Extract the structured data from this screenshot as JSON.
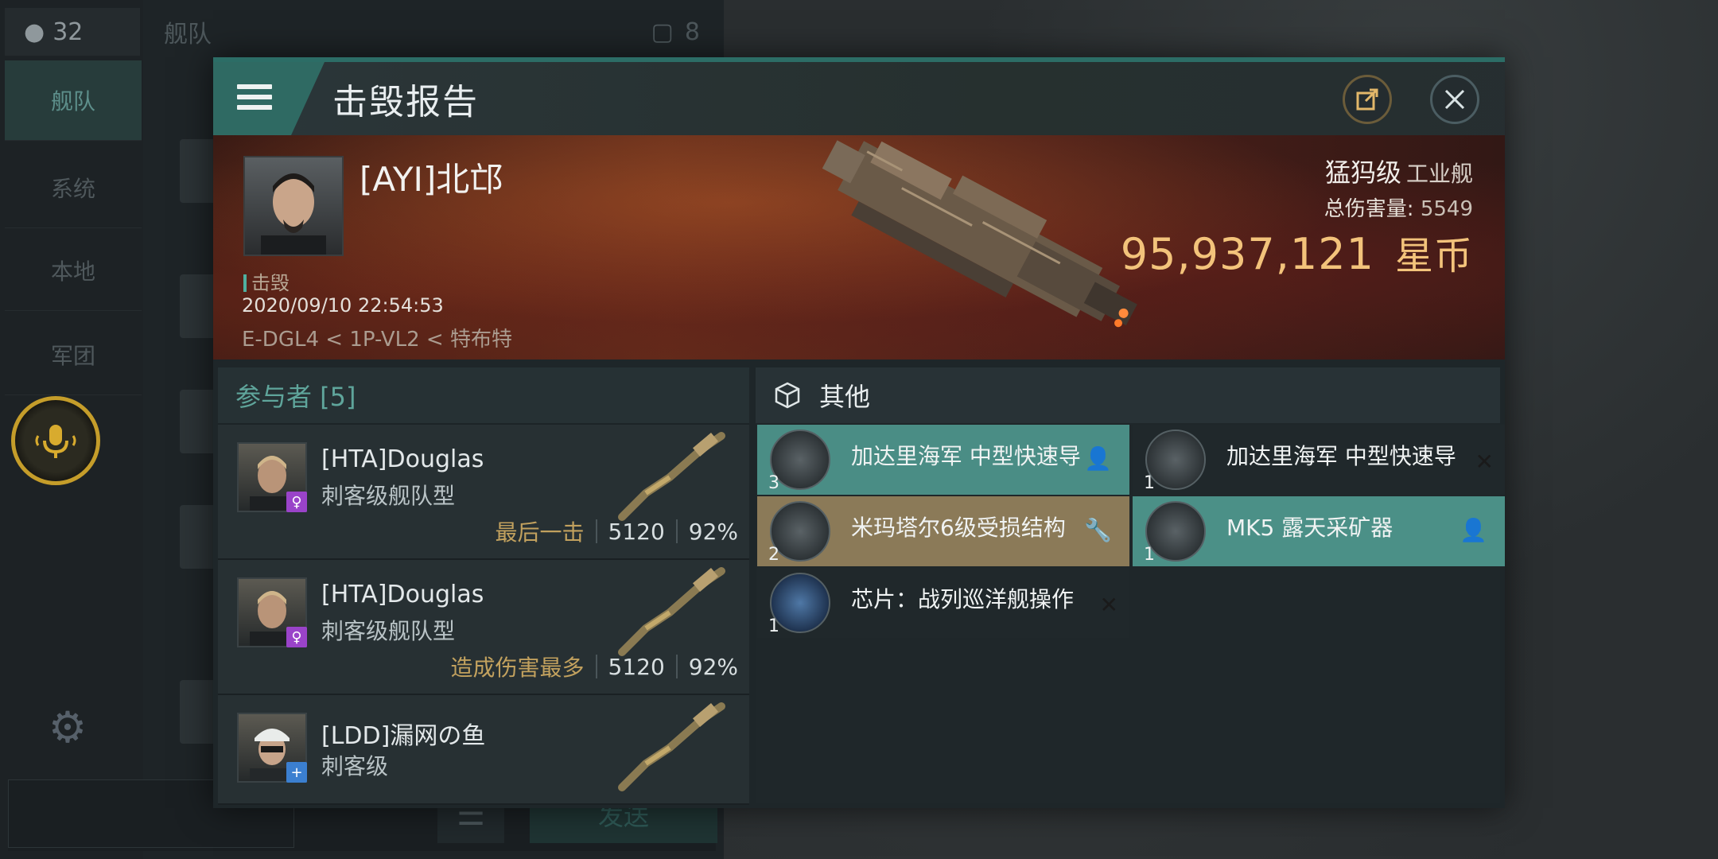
{
  "background": {
    "player_count": "32",
    "tabs": [
      "舰队",
      "系统",
      "本地",
      "军团"
    ],
    "chat_title": "舰队",
    "chat_member_count": "8",
    "input_placeholder": "",
    "send_label": "发送"
  },
  "modal": {
    "title": "击毁报告",
    "victim": {
      "name": "[AYI]北邙",
      "status": "击毁",
      "time": "2020/09/10 22:54:53",
      "location": "E-DGL4 < 1P-VL2 < 特布特"
    },
    "ship": {
      "class_name": "猛犸级",
      "class_type": "工业舰",
      "total_damage_label": "总伤害量:",
      "total_damage_value": "5549",
      "isk_value": "95,937,121",
      "currency": "星币"
    },
    "participants": {
      "header": "参与者 [5]",
      "rows": [
        {
          "name": "[HTA]Douglas",
          "ship": "刺客级舰队型",
          "tag": "最后一击",
          "damage": "5120",
          "percent": "92%",
          "badge": "♀",
          "badge_color": "#9a43c9"
        },
        {
          "name": "[HTA]Douglas",
          "ship": "刺客级舰队型",
          "tag": "造成伤害最多",
          "damage": "5120",
          "percent": "92%",
          "badge": "♀",
          "badge_color": "#9a43c9"
        },
        {
          "name": "[LDD]漏网の鱼",
          "ship": "刺客级",
          "tag": "",
          "damage": "",
          "percent": "",
          "badge": "+",
          "badge_color": "#3b7fd0"
        }
      ]
    },
    "items": {
      "header": "其他",
      "list": [
        {
          "name": "加达里海军 中型快速导",
          "qty": "3",
          "flag_icon": "person-icon"
        },
        {
          "name": "加达里海军 中型快速导",
          "qty": "1",
          "flag_icon": "destroyed-x-icon"
        },
        {
          "name": "米玛塔尔6级受损结构",
          "qty": "2",
          "flag_icon": "wrench-icon"
        },
        {
          "name": "MK5 露天采矿器",
          "qty": "1",
          "flag_icon": "person-icon"
        },
        {
          "name": "芯片：战列巡洋舰操作",
          "qty": "1",
          "flag_icon": "destroyed-x-icon"
        }
      ]
    }
  }
}
